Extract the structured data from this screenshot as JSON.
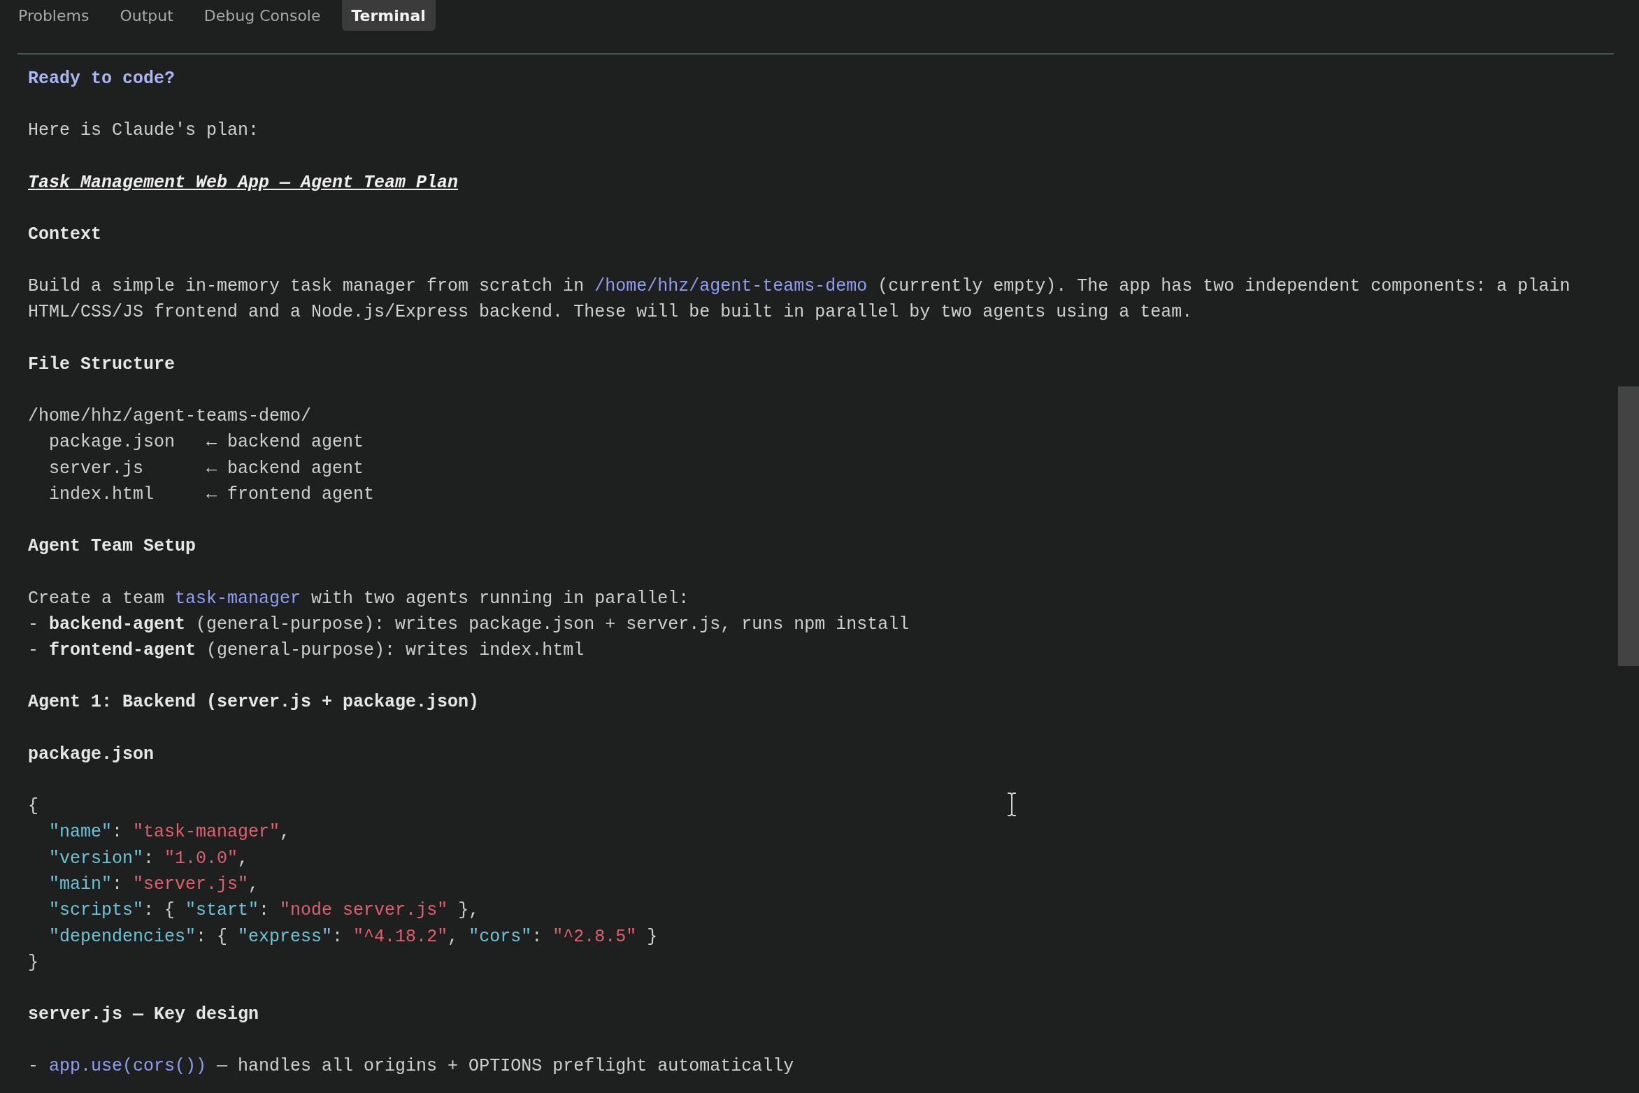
{
  "tabs": [
    {
      "label": "Problems",
      "selected": false
    },
    {
      "label": "Output",
      "selected": false
    },
    {
      "label": "Debug Console",
      "selected": false
    },
    {
      "label": "Terminal",
      "selected": true
    }
  ],
  "terminal": {
    "blocks": [
      {
        "lines": [
          [
            {
              "kind": "prompt",
              "text": "Ready to code?"
            }
          ]
        ]
      },
      {
        "lines": [
          [
            {
              "kind": "text",
              "text": "Here is Claude's plan:"
            }
          ]
        ]
      },
      {
        "lines": [
          [
            {
              "kind": "title",
              "text": "Task Management Web App — Agent Team Plan"
            }
          ]
        ]
      },
      {
        "lines": [
          [
            {
              "kind": "bold",
              "text": "Context"
            }
          ]
        ]
      },
      {
        "lines": [
          [
            {
              "kind": "text",
              "text": "Build a simple in-memory task manager from scratch in "
            },
            {
              "kind": "path",
              "text": "/home/hhz/agent-teams-demo"
            },
            {
              "kind": "text",
              "text": " (currently empty). The app has two independent components: a plain"
            }
          ],
          [
            {
              "kind": "text",
              "text": "HTML/CSS/JS frontend and a Node.js/Express backend. These will be built in parallel by two agents using a team."
            }
          ]
        ]
      },
      {
        "lines": [
          [
            {
              "kind": "bold",
              "text": "File Structure"
            }
          ]
        ]
      },
      {
        "lines": [
          [
            {
              "kind": "text",
              "text": "/home/hhz/agent-teams-demo/"
            }
          ],
          [
            {
              "kind": "text",
              "text": "  package.json   ← backend agent"
            }
          ],
          [
            {
              "kind": "text",
              "text": "  server.js      ← backend agent"
            }
          ],
          [
            {
              "kind": "text",
              "text": "  index.html     ← frontend agent"
            }
          ]
        ]
      },
      {
        "lines": [
          [
            {
              "kind": "bold",
              "text": "Agent Team Setup"
            }
          ]
        ]
      },
      {
        "lines": [
          [
            {
              "kind": "text",
              "text": "Create a team "
            },
            {
              "kind": "path",
              "text": "task-manager"
            },
            {
              "kind": "text",
              "text": " with two agents running in parallel:"
            }
          ],
          [
            {
              "kind": "text",
              "text": "- "
            },
            {
              "kind": "bold",
              "text": "backend-agent"
            },
            {
              "kind": "text",
              "text": " (general-purpose): writes package.json + server.js, runs npm install"
            }
          ],
          [
            {
              "kind": "text",
              "text": "- "
            },
            {
              "kind": "bold",
              "text": "frontend-agent"
            },
            {
              "kind": "text",
              "text": " (general-purpose): writes index.html"
            }
          ]
        ]
      },
      {
        "lines": [
          [
            {
              "kind": "bold",
              "text": "Agent 1: Backend (server.js + package.json)"
            }
          ]
        ]
      },
      {
        "lines": [
          [
            {
              "kind": "bold",
              "text": "package.json"
            }
          ]
        ]
      },
      {
        "lines": [
          [
            {
              "kind": "text",
              "text": "{"
            }
          ],
          [
            {
              "kind": "key",
              "text": "  \"name\""
            },
            {
              "kind": "text",
              "text": ": "
            },
            {
              "kind": "string",
              "text": "\"task-manager\""
            },
            {
              "kind": "text",
              "text": ","
            }
          ],
          [
            {
              "kind": "key",
              "text": "  \"version\""
            },
            {
              "kind": "text",
              "text": ": "
            },
            {
              "kind": "string",
              "text": "\"1.0.0\""
            },
            {
              "kind": "text",
              "text": ","
            }
          ],
          [
            {
              "kind": "key",
              "text": "  \"main\""
            },
            {
              "kind": "text",
              "text": ": "
            },
            {
              "kind": "string",
              "text": "\"server.js\""
            },
            {
              "kind": "text",
              "text": ","
            }
          ],
          [
            {
              "kind": "key",
              "text": "  \"scripts\""
            },
            {
              "kind": "text",
              "text": ": { "
            },
            {
              "kind": "key",
              "text": "\"start\""
            },
            {
              "kind": "text",
              "text": ": "
            },
            {
              "kind": "string",
              "text": "\"node server.js\""
            },
            {
              "kind": "text",
              "text": " },"
            }
          ],
          [
            {
              "kind": "key",
              "text": "  \"dependencies\""
            },
            {
              "kind": "text",
              "text": ": { "
            },
            {
              "kind": "key",
              "text": "\"express\""
            },
            {
              "kind": "text",
              "text": ": "
            },
            {
              "kind": "string",
              "text": "\"^4.18.2\""
            },
            {
              "kind": "text",
              "text": ", "
            },
            {
              "kind": "key",
              "text": "\"cors\""
            },
            {
              "kind": "text",
              "text": ": "
            },
            {
              "kind": "string",
              "text": "\"^2.8.5\""
            },
            {
              "kind": "text",
              "text": " }"
            }
          ],
          [
            {
              "kind": "text",
              "text": "}"
            }
          ]
        ]
      },
      {
        "lines": [
          [
            {
              "kind": "bold",
              "text": "server.js — Key design"
            }
          ]
        ]
      },
      {
        "lines": [
          [
            {
              "kind": "text",
              "text": "- "
            },
            {
              "kind": "path",
              "text": "app.use(cors())"
            },
            {
              "kind": "text",
              "text": " — handles all origins + OPTIONS preflight automatically"
            }
          ]
        ]
      }
    ]
  }
}
